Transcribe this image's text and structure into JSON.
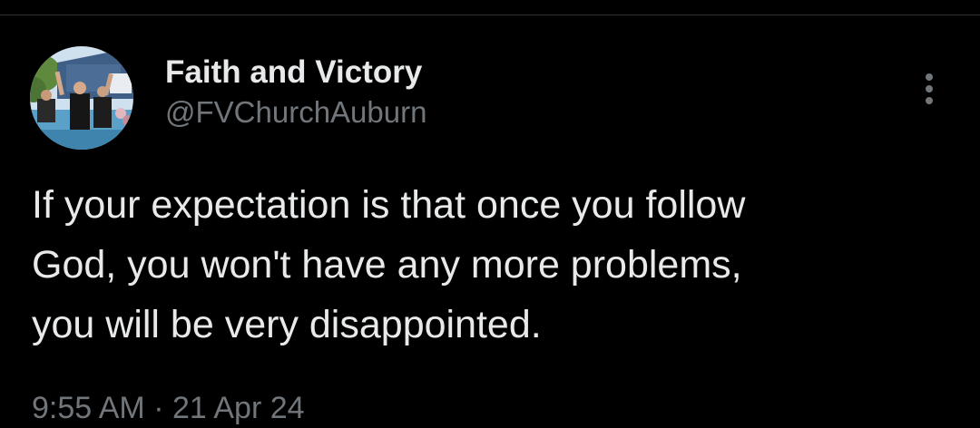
{
  "tweet": {
    "author": {
      "display_name": "Faith and Victory",
      "handle": "@FVChurchAuburn"
    },
    "text_lines": [
      "If your expectation is that once you follow",
      "God, you won't have any more problems,",
      "you will be very disappointed."
    ],
    "time": "9:55 AM",
    "separator": "·",
    "date": "21 Apr 24"
  },
  "icons": {
    "more": "more-vertical-icon"
  },
  "colors": {
    "background": "#000000",
    "primary_text": "#e7e9ea",
    "secondary_text": "#71767b",
    "divider": "#2f3336"
  }
}
